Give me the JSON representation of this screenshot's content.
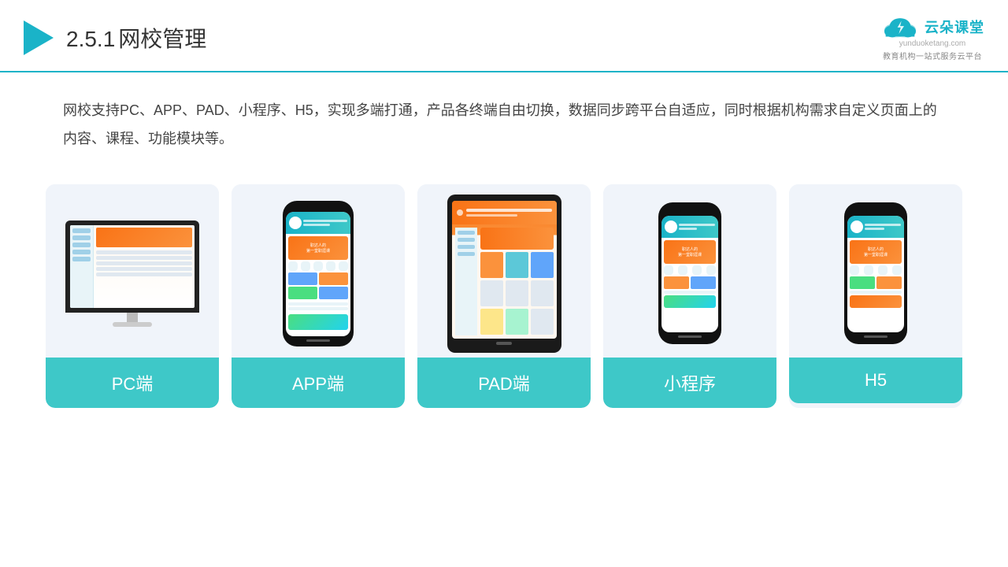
{
  "header": {
    "title_num": "2.5.1",
    "title_text": "网校管理",
    "logo_main": "云朵课堂",
    "logo_url": "yunduoketang.com",
    "logo_tagline": "教育机构一站式服务云平台"
  },
  "description": {
    "text": "网校支持PC、APP、PAD、小程序、H5，实现多端打通，产品各终端自由切换，数据同步跨平台自适应，同时根据机构需求自定义页面上的内容、课程、功能模块等。"
  },
  "cards": [
    {
      "id": "pc",
      "label": "PC端"
    },
    {
      "id": "app",
      "label": "APP端"
    },
    {
      "id": "pad",
      "label": "PAD端"
    },
    {
      "id": "miniprogram",
      "label": "小程序"
    },
    {
      "id": "h5",
      "label": "H5"
    }
  ],
  "colors": {
    "accent": "#1ab3c8",
    "card_bg": "#f0f4fa",
    "label_bg": "#3ec8c8",
    "header_border": "#1ab3c8",
    "title_color": "#333"
  }
}
